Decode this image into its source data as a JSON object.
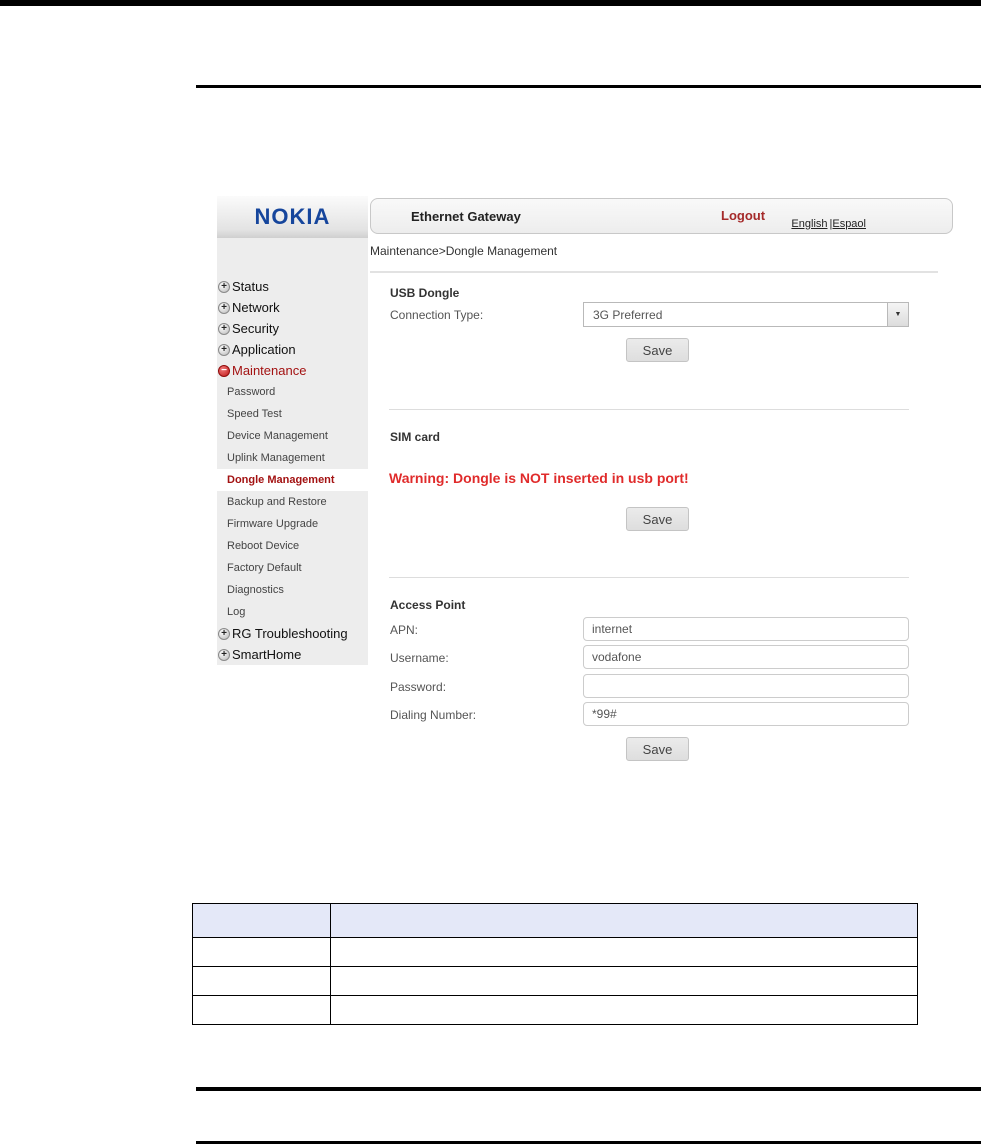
{
  "router": {
    "logo_text": "NOKIA",
    "header": {
      "title": "Ethernet Gateway",
      "logout": "Logout",
      "languages": {
        "english": "English",
        "spanish": "|Espaol"
      }
    },
    "breadcrumb": "Maintenance>Dongle Management",
    "sidebar": {
      "items": [
        {
          "label": "Status",
          "toggle": "+",
          "level": "top"
        },
        {
          "label": "Network",
          "toggle": "+",
          "level": "top"
        },
        {
          "label": "Security",
          "toggle": "+",
          "level": "top"
        },
        {
          "label": "Application",
          "toggle": "+",
          "level": "top"
        },
        {
          "label": "Maintenance",
          "toggle": "−",
          "level": "top",
          "state": "expanded"
        },
        {
          "label": "Password",
          "toggle": "",
          "level": "sub"
        },
        {
          "label": "Speed Test",
          "toggle": "",
          "level": "sub"
        },
        {
          "label": "Device Management",
          "toggle": "",
          "level": "sub"
        },
        {
          "label": "Uplink Management",
          "toggle": "",
          "level": "sub"
        },
        {
          "label": "Dongle Management",
          "toggle": "",
          "level": "sub",
          "state": "active"
        },
        {
          "label": "Backup and Restore",
          "toggle": "",
          "level": "sub"
        },
        {
          "label": "Firmware Upgrade",
          "toggle": "",
          "level": "sub"
        },
        {
          "label": "Reboot Device",
          "toggle": "",
          "level": "sub"
        },
        {
          "label": "Factory Default",
          "toggle": "",
          "level": "sub"
        },
        {
          "label": "Diagnostics",
          "toggle": "",
          "level": "sub"
        },
        {
          "label": "Log",
          "toggle": "",
          "level": "sub"
        },
        {
          "label": "RG Troubleshooting",
          "toggle": "+",
          "level": "top"
        },
        {
          "label": "SmartHome",
          "toggle": "+",
          "level": "top"
        }
      ]
    },
    "usb_dongle": {
      "title": "USB Dongle",
      "connection_type_label": "Connection Type:",
      "connection_type_value": "3G Preferred",
      "dropdown_arrow": "▼",
      "save_label": "Save"
    },
    "sim_card": {
      "title": "SIM card",
      "warning": "Warning: Dongle is NOT inserted in usb port!",
      "save_label": "Save"
    },
    "access_point": {
      "title": "Access Point",
      "fields": [
        {
          "label": "APN:",
          "value": "internet"
        },
        {
          "label": "Username:",
          "value": "vodafone"
        },
        {
          "label": "Password:",
          "value": ""
        },
        {
          "label": "Dialing Number:",
          "value": "*99#"
        }
      ],
      "save_label": "Save"
    }
  },
  "table": {
    "header": [
      "",
      ""
    ],
    "rows": [
      [
        "",
        ""
      ],
      [
        "",
        ""
      ],
      [
        "",
        ""
      ]
    ]
  },
  "colors": {
    "nokia_blue": "#15459c",
    "logout_red": "#a52a2a",
    "warning_red": "#e02b2b",
    "active_item_red": "#a31212",
    "table_header_bg": "#e4e8f8"
  }
}
